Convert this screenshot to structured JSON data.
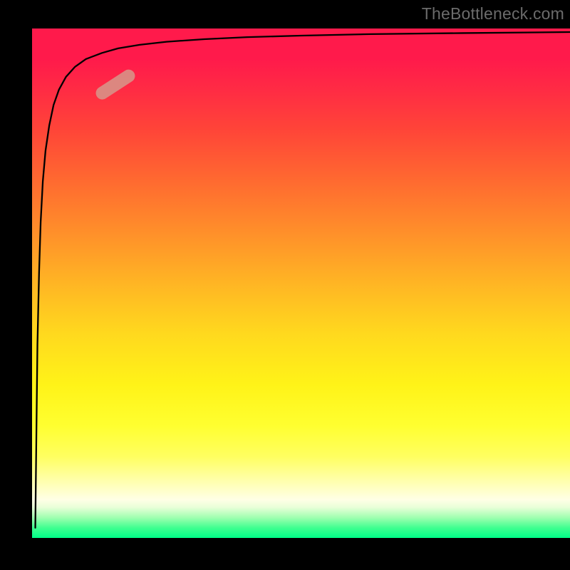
{
  "watermark": {
    "text": "TheBottleneck.com"
  },
  "chart_data": {
    "type": "line",
    "title": "",
    "xlabel": "",
    "ylabel": "",
    "xlim": [
      0,
      100
    ],
    "ylim": [
      0,
      100
    ],
    "x": [
      0.6,
      0.8,
      1.0,
      1.3,
      1.6,
      2.0,
      2.5,
      3.2,
      4.0,
      5.0,
      6.3,
      8.0,
      10,
      13,
      16,
      20,
      25,
      32,
      40,
      50,
      63,
      80,
      100
    ],
    "values": [
      2,
      20,
      38,
      52,
      62,
      70,
      76,
      81,
      85,
      88,
      90.5,
      92.5,
      94,
      95.2,
      96.1,
      96.8,
      97.4,
      97.9,
      98.3,
      98.6,
      98.9,
      99.1,
      99.3
    ],
    "marker": {
      "x": 15.5,
      "y": 89,
      "angle_deg": -33
    },
    "background_gradient": {
      "top": "#ff1a4b",
      "mid": "#fff318",
      "bottom": "#00ff88"
    }
  }
}
